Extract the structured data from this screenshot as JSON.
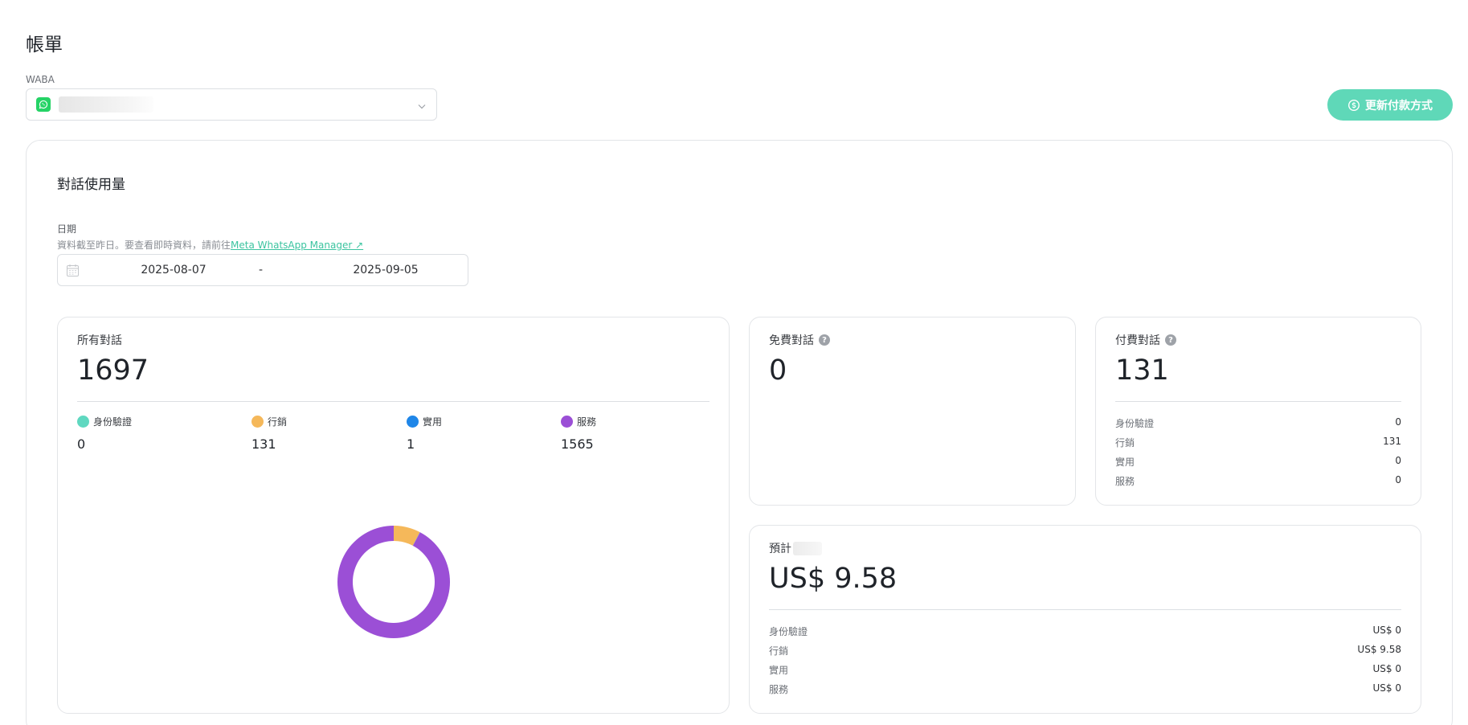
{
  "page": {
    "title": "帳單"
  },
  "waba": {
    "label": "WABA",
    "value": ""
  },
  "actions": {
    "update_payment": "更新付款方式"
  },
  "usage": {
    "title": "對話使用量",
    "date_label": "日期",
    "date_hint": "資料截至昨日。要查看即時資料，請前往",
    "date_hint_link": "Meta WhatsApp Manager ↗",
    "start_date": "2025-08-07",
    "separator": "-",
    "end_date": "2025-09-05"
  },
  "all_conversations": {
    "label": "所有對話",
    "total": "1697",
    "categories": [
      {
        "label": "身份驗證",
        "value": "0",
        "color": "#5fd8c0"
      },
      {
        "label": "行銷",
        "value": "131",
        "color": "#f5b85a"
      },
      {
        "label": "實用",
        "value": "1",
        "color": "#1f86e8"
      },
      {
        "label": "服務",
        "value": "1565",
        "color": "#9b4fd6"
      }
    ]
  },
  "chart_data": {
    "type": "pie",
    "donut": true,
    "categories": [
      "身份驗證",
      "行銷",
      "實用",
      "服務"
    ],
    "values": [
      0,
      131,
      1,
      1565
    ],
    "colors": [
      "#5fd8c0",
      "#f5b85a",
      "#1f86e8",
      "#9b4fd6"
    ]
  },
  "free_conversations": {
    "label": "免費對話",
    "total": "0"
  },
  "paid_conversations": {
    "label": "付費對話",
    "total": "131",
    "rows": [
      {
        "label": "身份驗證",
        "value": "0"
      },
      {
        "label": "行銷",
        "value": "131"
      },
      {
        "label": "實用",
        "value": "0"
      },
      {
        "label": "服務",
        "value": "0"
      }
    ]
  },
  "estimate": {
    "label": "預計",
    "total": "US$ 9.58",
    "rows": [
      {
        "label": "身份驗證",
        "value": "US$ 0"
      },
      {
        "label": "行銷",
        "value": "US$ 9.58"
      },
      {
        "label": "實用",
        "value": "US$ 0"
      },
      {
        "label": "服務",
        "value": "US$ 0"
      }
    ]
  }
}
